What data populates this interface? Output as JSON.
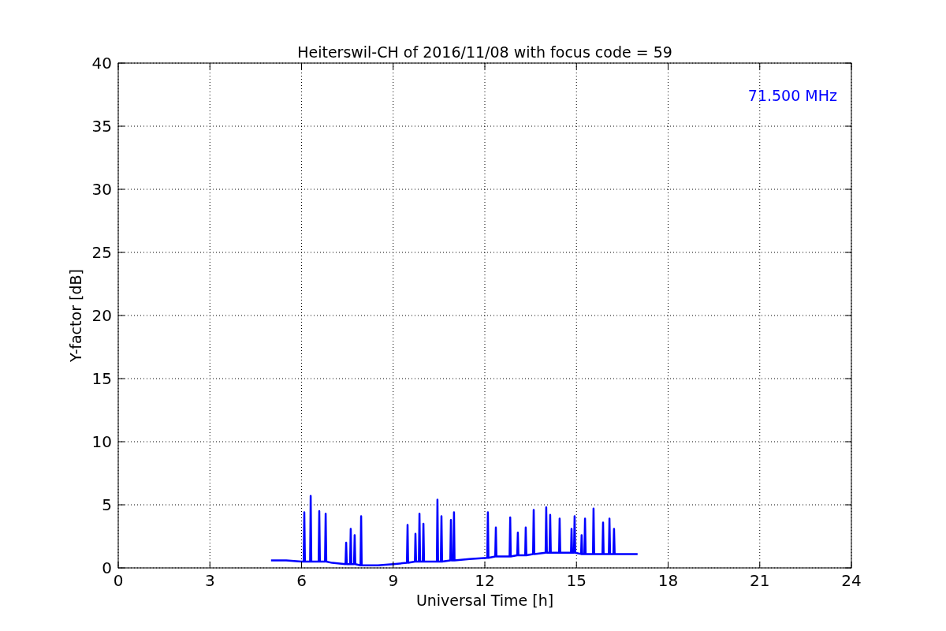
{
  "chart_data": {
    "type": "line",
    "title": "Heiterswil-CH of 2016/11/08 with focus code = 59",
    "xlabel": "Universal Time [h]",
    "ylabel": "Y-factor [dB]",
    "xlim": [
      0,
      24
    ],
    "ylim": [
      0,
      40
    ],
    "xticks": [
      0,
      3,
      6,
      9,
      12,
      15,
      18,
      21,
      24
    ],
    "yticks": [
      0,
      5,
      10,
      15,
      20,
      25,
      30,
      35,
      40
    ],
    "x": [
      5.0,
      5.5,
      6.0,
      6.07,
      6.09,
      6.11,
      6.28,
      6.3,
      6.32,
      6.56,
      6.58,
      6.6,
      6.77,
      6.79,
      6.81,
      7.0,
      7.44,
      7.46,
      7.48,
      7.59,
      7.61,
      7.63,
      7.72,
      7.74,
      7.76,
      7.93,
      7.95,
      7.97,
      8.5,
      9.0,
      9.45,
      9.47,
      9.49,
      9.71,
      9.73,
      9.75,
      9.84,
      9.86,
      9.88,
      9.97,
      9.99,
      10.01,
      10.43,
      10.45,
      10.47,
      10.56,
      10.58,
      10.6,
      10.87,
      10.89,
      10.91,
      10.97,
      10.99,
      11.01,
      11.5,
      12.08,
      12.1,
      12.12,
      12.34,
      12.36,
      12.38,
      12.81,
      12.83,
      12.85,
      13.06,
      13.08,
      13.1,
      13.32,
      13.34,
      13.36,
      13.58,
      13.6,
      13.62,
      13.99,
      14.01,
      14.03,
      14.12,
      14.14,
      14.16,
      14.43,
      14.45,
      14.47,
      14.82,
      14.84,
      14.86,
      14.92,
      14.94,
      14.96,
      15.15,
      15.17,
      15.19,
      15.26,
      15.28,
      15.3,
      15.54,
      15.56,
      15.58,
      15.85,
      15.87,
      15.89,
      16.06,
      16.08,
      16.1,
      16.21,
      16.23,
      16.25,
      16.6,
      17.0
    ],
    "series": [
      {
        "color": "#0000ff",
        "values": [
          0.6,
          0.6,
          0.5,
          0.5,
          4.4,
          0.5,
          0.5,
          5.7,
          0.5,
          0.5,
          4.5,
          0.5,
          0.5,
          4.3,
          0.5,
          0.4,
          0.3,
          2.0,
          0.3,
          0.3,
          3.1,
          0.3,
          0.3,
          2.6,
          0.3,
          0.2,
          4.1,
          0.2,
          0.2,
          0.3,
          0.4,
          3.4,
          0.4,
          0.5,
          2.7,
          0.5,
          0.5,
          4.3,
          0.5,
          0.5,
          3.5,
          0.5,
          0.5,
          5.4,
          0.5,
          0.5,
          4.1,
          0.5,
          0.6,
          3.8,
          0.6,
          0.6,
          4.4,
          0.6,
          0.7,
          0.8,
          4.4,
          0.8,
          0.9,
          3.2,
          0.9,
          0.9,
          4.0,
          0.9,
          1.0,
          2.8,
          1.0,
          1.0,
          3.2,
          1.0,
          1.1,
          4.6,
          1.1,
          1.2,
          4.8,
          1.2,
          1.2,
          4.2,
          1.2,
          1.2,
          3.9,
          1.2,
          1.2,
          3.1,
          1.2,
          1.2,
          4.1,
          1.2,
          1.1,
          2.6,
          1.1,
          1.1,
          3.9,
          1.1,
          1.1,
          4.7,
          1.1,
          1.1,
          3.6,
          1.1,
          1.1,
          3.9,
          1.1,
          1.1,
          3.1,
          1.1,
          1.1,
          1.1
        ]
      }
    ],
    "grid": true,
    "annotations": [
      {
        "text": "71.500 MHz"
      }
    ]
  }
}
